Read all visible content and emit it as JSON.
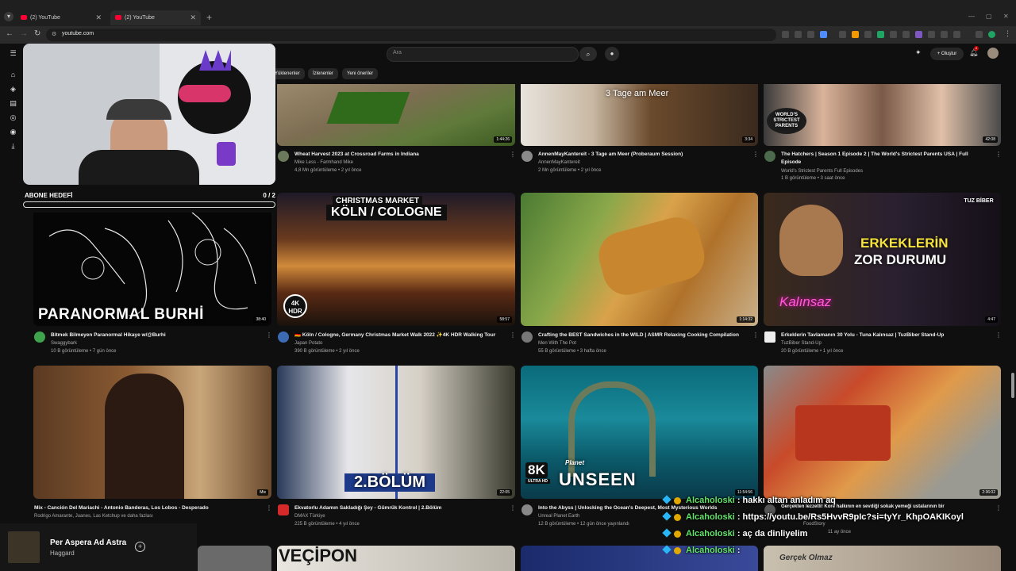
{
  "browser": {
    "tabs": [
      {
        "label": "(2) YouTube",
        "active": false
      },
      {
        "label": "(2) YouTube",
        "active": true
      }
    ],
    "url": "youtube.com"
  },
  "youtube": {
    "search_placeholder": "Ara",
    "create_label": "Oluştur",
    "notification_count": "2",
    "chips": [
      "Yüklenenler",
      "İzlenenler",
      "Yeni öneriler"
    ]
  },
  "videos": [
    {
      "title": "Wheat Harvest 2023 at Crossroad Farms in Indiana",
      "channel": "Mike Less - Farmhand Mike",
      "stats": "4,8 Mn görüntüleme • 2 yıl önce",
      "duration": "1:44:26",
      "overlay": ""
    },
    {
      "title": "AnnenMayKantereit - 3 Tage am Meer (Proberaum Session)",
      "channel": "AnnenMayKantereit",
      "stats": "2 Mn görüntüleme • 2 yıl önce",
      "duration": "3:34",
      "overlay": "3 Tage am Meer"
    },
    {
      "title": "The Hatchers | Season 1 Episode 2 | The World's Strictest Parents USA | Full",
      "title2": "Episode",
      "channel": "World's Strictest Parents Full Episodes",
      "stats": "1 B görüntüleme • 3 saat önce",
      "duration": "42:08",
      "overlay": "WORLD'S STRICTEST PARENTS"
    },
    {
      "title": "Bitmek Bilmeyen Paranormal Hikaye w/@Burhi",
      "channel": "Swaggybark",
      "stats": "10 B görüntüleme • 7 gün önce",
      "duration": "38:40",
      "overlay": "PARANORMAL BURHİ"
    },
    {
      "title": "🇩🇪 Köln / Cologne, Germany Christmas Market Walk 2022 ✨4K HDR Walking Tour",
      "channel": "Japan Potato",
      "stats": "390 B görüntüleme • 2 yıl önce",
      "duration": "58:57",
      "overlay": "CHRISTMAS MARKET",
      "overlay2": "KÖLN / COLOGNE",
      "overlay3": "4K HDR"
    },
    {
      "title": "Crafting the BEST Sandwiches in the WILD | ASMR Relaxing Cooking Compilation",
      "channel": "Men With The Pot",
      "stats": "55 B görüntüleme • 3 hafta önce",
      "duration": "1:14:32",
      "overlay": ""
    },
    {
      "title": "Erkeklerin Tavlamanın 30 Yolu - Tuna Kalınsaz | TuzBiber Stand-Up",
      "channel": "TuzBiber Stand-Up",
      "stats": "20 B görüntüleme • 1 yıl önce",
      "duration": "4:47",
      "overlay": "ERKEKLERİN",
      "overlay2": "ZOR DURUMU",
      "overlay3": "Kalınsaz",
      "overlay4": "TUZ BİBER"
    },
    {
      "title": "Mix - Canción Del Mariachi - Antonio Banderas, Los Lobos - Desperado",
      "channel": "Rodrigo Amarante, Juanes, Las Ketchup ve daha fazlası",
      "stats": "",
      "duration": "Mix",
      "overlay": ""
    },
    {
      "title": "Ekvatorlu Adamın Sakladığı Şey - Gümrük Kontrol | 2.Bölüm",
      "channel": "DMAX Türkiye",
      "stats": "225 B görüntüleme • 4 yıl önce",
      "duration": "22:05",
      "overlay": "2.BÖLÜM"
    },
    {
      "title": "Into the Abyss | Unlocking the Ocean's Deepest, Most Mysterious Worlds",
      "channel": "Unreal Planet Earth",
      "stats": "12 B görüntüleme • 12 gün önce yayınlandı",
      "duration": "11:54:56",
      "overlay": "8K",
      "overlay2": "UNSEEN",
      "overlay3": "ULTRA HD",
      "overlay4": "Planet"
    },
    {
      "title": "Gerçekten lezzetli! Kore halkının en sevdiği sokak yemeği ustalarının bir",
      "channel": "FoodStory",
      "stats": "11 ay önce",
      "duration": "2:36:02",
      "overlay": ""
    }
  ],
  "bottom_row": [
    "VEÇİPON",
    "Gerçek Olmaz"
  ],
  "overlays": {
    "sub_goal": {
      "label": "ABONE HEDEFİ",
      "count": "0 / 2",
      "progress": 0.0
    },
    "chat": [
      {
        "user": "Alcaholoski",
        "text": ": hakkı altan anladım aq"
      },
      {
        "user": "Alcaholoski",
        "text": ": https://youtu.be/Rs5HvvR9pIc?si=tyYr_KhpOAKIKoyl"
      },
      {
        "user": "Alcaholoski",
        "text": ": aç da dinliyelim"
      },
      {
        "user": "Alcaholoski",
        "text": ":"
      }
    ],
    "music": {
      "song": "Per Aspera Ad Astra",
      "artist": "Haggard"
    }
  },
  "colors": {
    "yt_red": "#ff0033",
    "chat_user": "#63e46b",
    "bg": "#0f0f0f"
  }
}
